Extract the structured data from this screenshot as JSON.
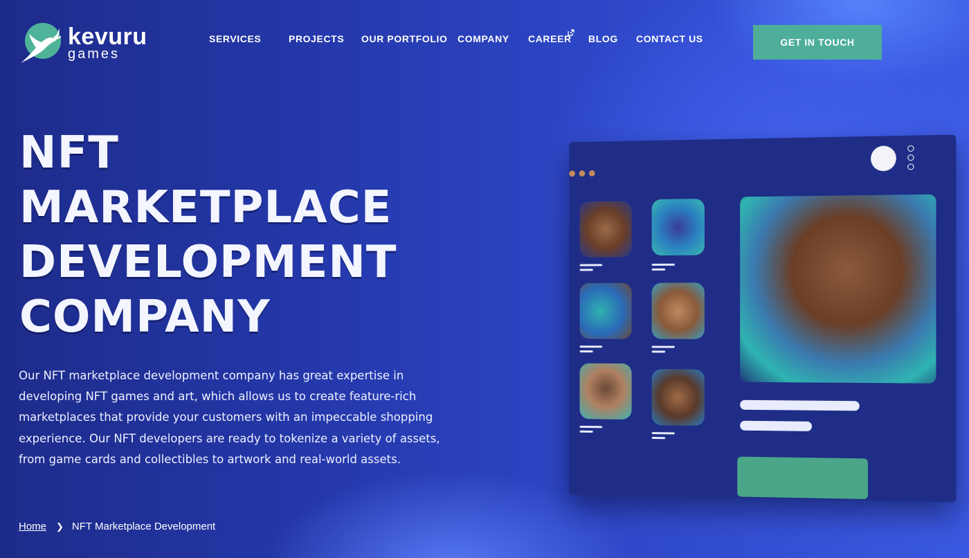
{
  "brand": {
    "name": "kevuru",
    "sub": "games"
  },
  "nav": {
    "items": [
      {
        "label": "SERVICES"
      },
      {
        "label": "PROJECTS"
      },
      {
        "label": "OUR PORTFOLIO"
      },
      {
        "label": "COMPANY"
      },
      {
        "label": "CAREER"
      },
      {
        "label": "BLOG"
      },
      {
        "label": "CONTACT US"
      }
    ],
    "cta": "GET IN TOUCH"
  },
  "hero": {
    "title_lines": [
      "NFT",
      "MARKETPLACE",
      "DEVELOPMENT",
      "COMPANY"
    ],
    "description": "Our NFT marketplace development company has great expertise in developing NFT games and art, which allows us to create feature-rich marketplaces that provide your customers with an impeccable shopping experience. Our NFT developers are ready to tokenize a variety of assets, from game cards and collectibles to artwork and real-world assets."
  },
  "breadcrumb": {
    "home": "Home",
    "current": "NFT Marketplace Development"
  },
  "colors": {
    "accent": "#4fae9a",
    "panel": "#1f2d86",
    "background": "#2d46c6"
  },
  "icons": {
    "career_link": "external-link-icon",
    "breadcrumb_separator": "chevron-right-icon"
  }
}
